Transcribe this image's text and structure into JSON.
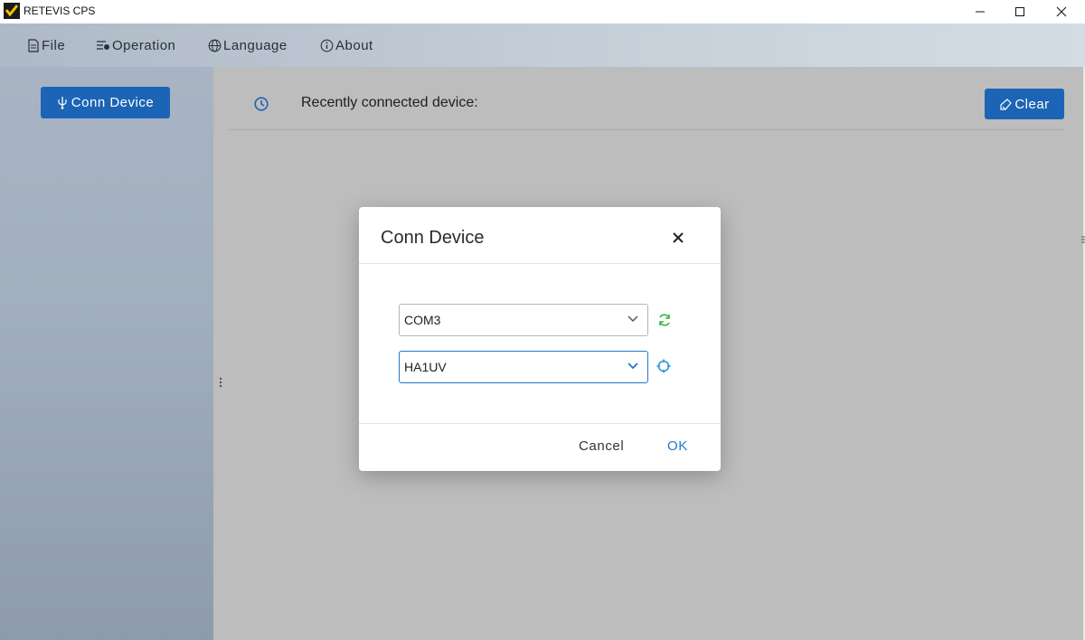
{
  "window": {
    "title": "RETEVIS CPS"
  },
  "menu": {
    "file": "File",
    "operation": "Operation",
    "language": "Language",
    "about": "About"
  },
  "sidebar": {
    "conn_device_label": "Conn Device"
  },
  "main": {
    "recent_label": "Recently connected device:",
    "clear_label": "Clear"
  },
  "dialog": {
    "title": "Conn Device",
    "port_value": "COM3",
    "model_value": "HA1UV",
    "cancel_label": "Cancel",
    "ok_label": "OK"
  },
  "colors": {
    "primary": "#1c64b6",
    "ok_text": "#1f78c9",
    "refresh_icon": "#3cae4a",
    "target_icon": "#2a9ad8",
    "overlay_gray": "#bdbdbd"
  },
  "icons": {
    "logo": "app-logo-icon",
    "file": "file-icon",
    "operation": "operation-icon",
    "language": "globe-icon",
    "about": "info-icon",
    "conn": "usb-icon",
    "history": "history-icon",
    "clear": "broom-icon",
    "refresh": "refresh-icon",
    "target": "target-icon",
    "close": "close-icon"
  }
}
